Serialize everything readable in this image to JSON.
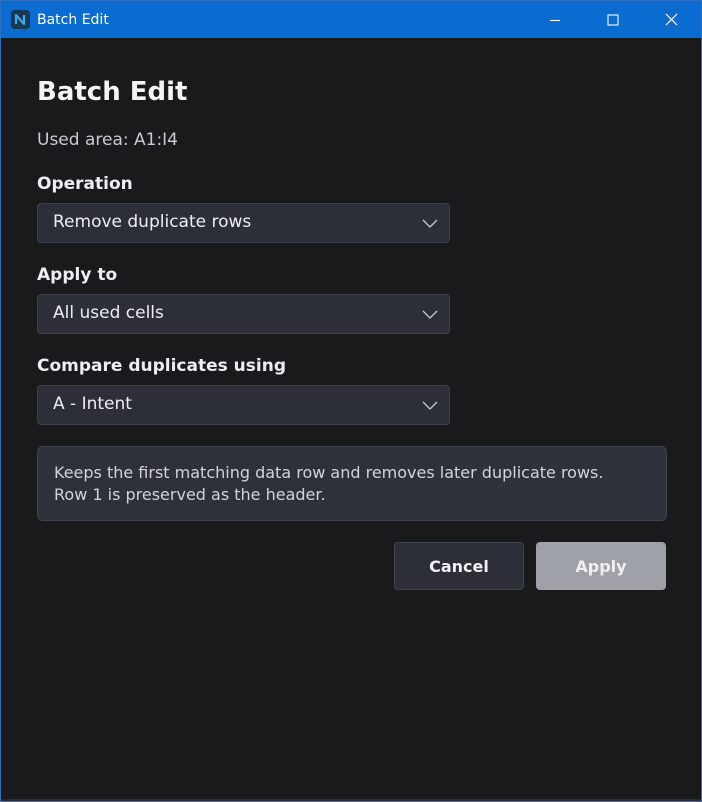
{
  "window": {
    "title": "Batch Edit",
    "controls": {
      "minimize_icon": "minimize-icon",
      "maximize_icon": "maximize-icon",
      "close_icon": "close-icon"
    },
    "app_icon": "app-logo-icon",
    "titlebar_color": "#0a6bd1"
  },
  "dialog": {
    "heading": "Batch Edit",
    "used_area": "Used area: A1:I4",
    "operation": {
      "label": "Operation",
      "value": "Remove duplicate rows"
    },
    "apply_to": {
      "label": "Apply to",
      "value": "All used cells"
    },
    "compare": {
      "label": "Compare duplicates using",
      "value": "A - Intent"
    },
    "info": {
      "line1": "Keeps the first matching data row and removes later duplicate rows.",
      "line2": "Row 1 is preserved as the header."
    },
    "buttons": {
      "cancel": "Cancel",
      "apply": "Apply"
    }
  }
}
